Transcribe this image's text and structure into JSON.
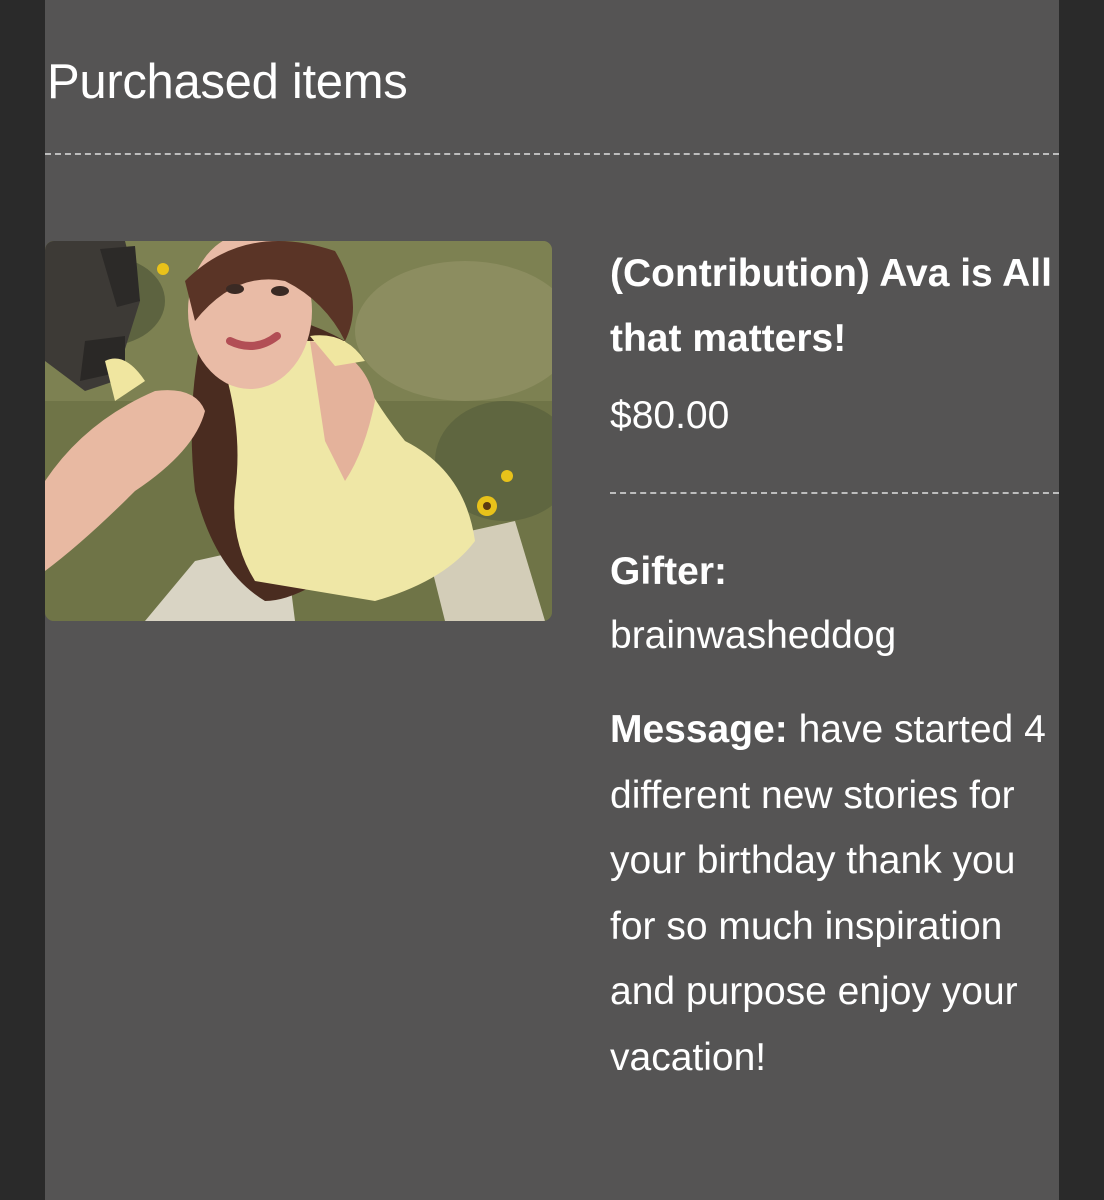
{
  "heading": "Purchased items",
  "item": {
    "title": "(Contribution) Ava is All that matters!",
    "price": "$80.00",
    "gifter_label": "Gifter:",
    "gifter_name": "brainwasheddog",
    "message_label": "Message:",
    "message_text": "have started 4 different new stories for your birthday thank you for so much inspiration and purpose enjoy your vacation!"
  },
  "colors": {
    "page_background": "#2a2a2a",
    "panel_background": "#555454",
    "text": "#ffffff",
    "divider": "#bdbdbd"
  }
}
